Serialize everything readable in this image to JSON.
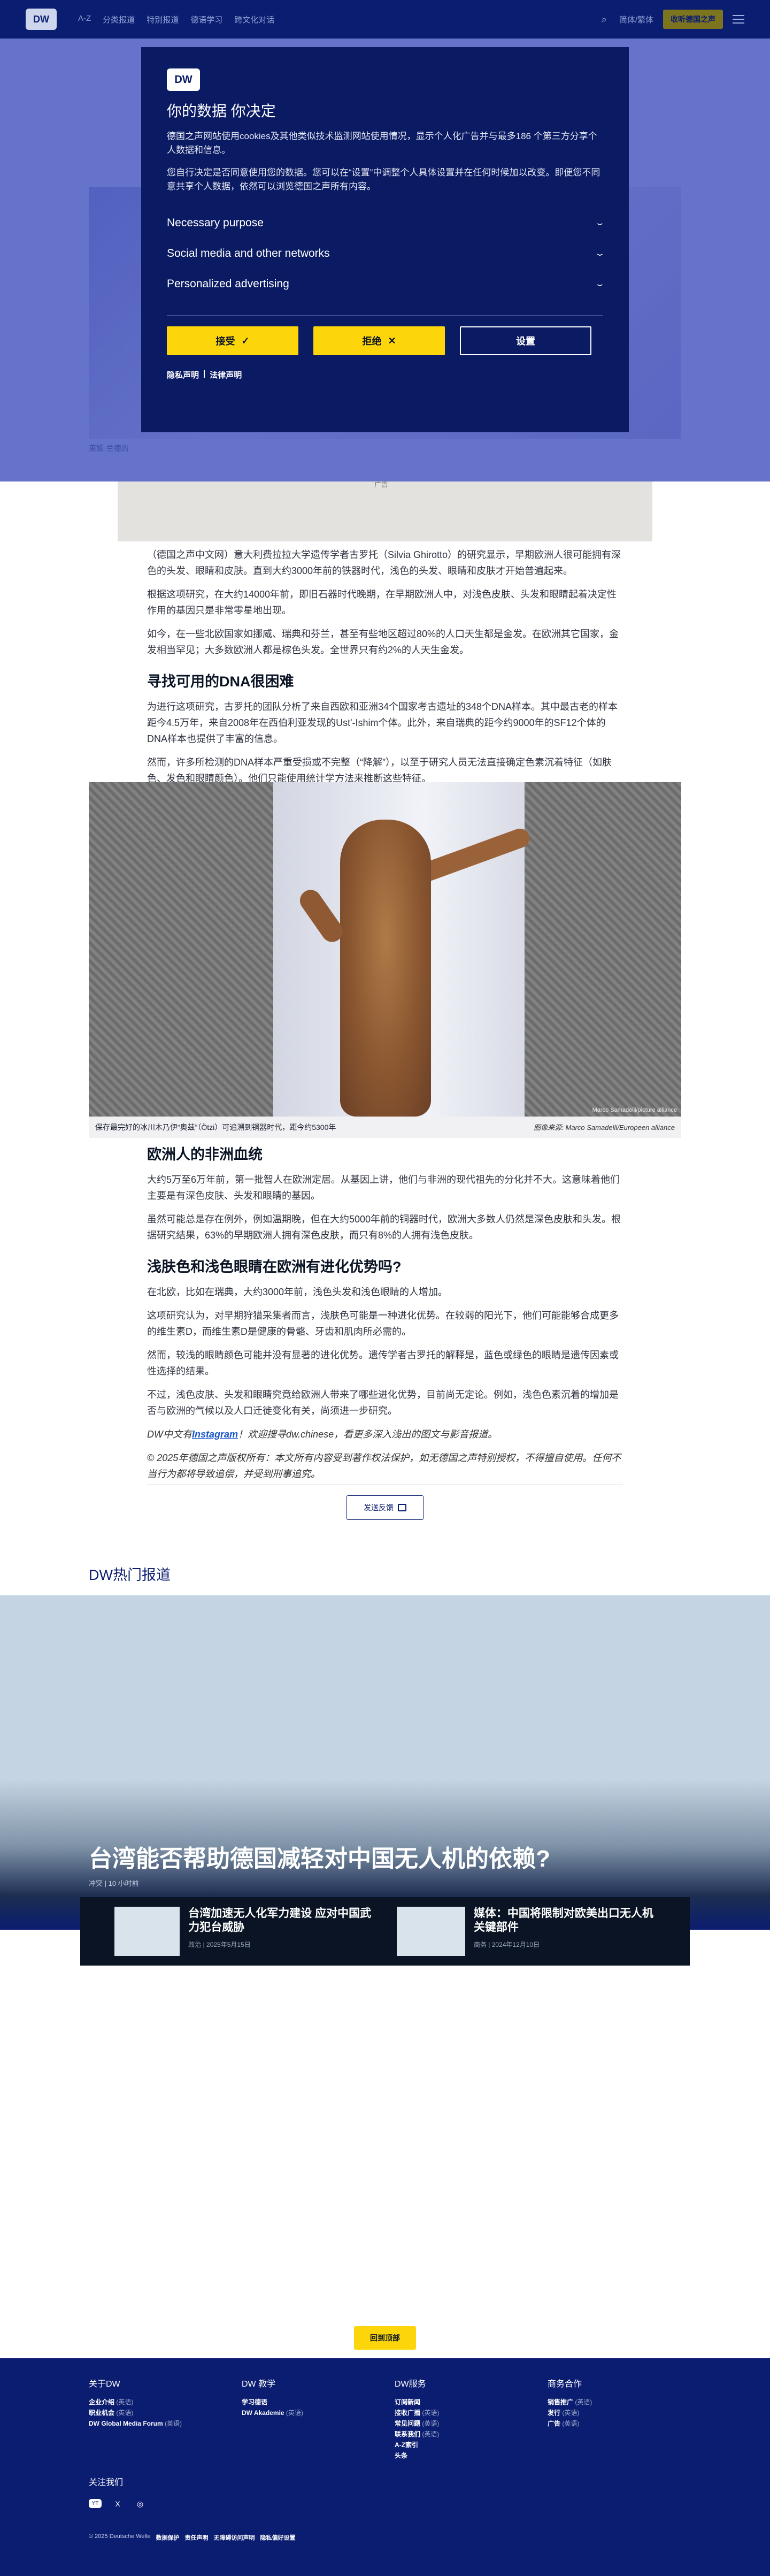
{
  "header": {
    "logo": "DW",
    "nav": [
      "A-Z",
      "分类报道",
      "特别报道",
      "德语学习",
      "跨文化对话"
    ],
    "lang": "简体/繁体",
    "cta": "收听德国之声"
  },
  "hero": {
    "caption": "莱娅·兰德的"
  },
  "consent": {
    "logo": "DW",
    "title": "你的数据 你决定",
    "p1": "德国之声网站使用cookies及其他类似技术监测网站使用情况，显示个人化广告并与最多186 个第三方分享个人数据和信息。",
    "p2": "您自行决定是否同意使用您的数据。您可以在“设置”中调整个人具体设置并在任何时候加以改变。即便您不同意共享个人数据，依然可以浏览德国之声所有内容。",
    "items": [
      "Necessary purpose",
      "Social media and other networks",
      "Personalized advertising"
    ],
    "accept": "接受",
    "reject": "拒绝",
    "settings": "设置",
    "privacy": "隐私声明",
    "legal": "法律声明",
    "sep": "|"
  },
  "article": {
    "strip_text": "广告",
    "p1": "（德国之声中文网）意大利费拉拉大学遗传学者古罗托（Silvia Ghirotto）的研究显示，早期欧洲人很可能拥有深色的头发、眼睛和皮肤。直到大约3000年前的铁器时代，浅色的头发、眼睛和皮肤才开始普遍起来。",
    "p2": "根据这项研究，在大约14000年前，即旧石器时代晚期，在早期欧洲人中，对浅色皮肤、头发和眼睛起着决定性作用的基因只是非常零星地出现。",
    "p3": "如今，在一些北欧国家如挪威、瑞典和芬兰，甚至有些地区超过80%的人口天生都是金发。在欧洲其它国家，金发相当罕见；大多数欧洲人都是棕色头发。全世界只有约2%的人天生金发。",
    "h1": "寻找可用的DNA很困难",
    "p4": "为进行这项研究，古罗托的团队分析了来自西欧和亚洲34个国家考古遗址的348个DNA样本。其中最古老的样本距今4.5万年，来自2008年在西伯利亚发现的Ust'-Ishim个体。此外，来自瑞典的距今约9000年的SF12个体的DNA样本也提供了丰富的信息。",
    "p5": "然而，许多所检测的DNA样本严重受损或不完整（“降解”），以至于研究人员无法直接确定色素沉着特征（如肤色、发色和眼睛颜色）。他们只能使用统计学方法来推断这些特征。"
  },
  "figure": {
    "caption": "保存最完好的冰川木乃伊“奥兹”（Ötzi）可追溯到铜器时代，距今约5300年",
    "credit": "图像来源: Marco Samadelli/Europeen alliance",
    "credit_in": "Marco Samadelli/picture alliance"
  },
  "article2": {
    "h1": "欧洲人的非洲血统",
    "p1": "大约5万至6万年前，第一批智人在欧洲定居。从基因上讲，他们与非洲的现代祖先的分化并不大。这意味着他们主要是有深色皮肤、头发和眼睛的基因。",
    "p2": "虽然可能总是存在例外，例如温期晚，但在大约5000年前的铜器时代，欧洲大多数人仍然是深色皮肤和头发。根据研究结果，63%的早期欧洲人拥有深色皮肤，而只有8%的人拥有浅色皮肤。",
    "h2": "浅肤色和浅色眼睛在欧洲有进化优势吗?",
    "p3": "在北欧，比如在瑞典，大约3000年前，浅色头发和浅色眼睛的人增加。",
    "p4": "这项研究认为，对早期狩猎采集者而言，浅肤色可能是一种进化优势。在较弱的阳光下，他们可能能够合成更多的维生素D，而维生素D是健康的骨骼、牙齿和肌肉所必需的。",
    "p5": "然而，较浅的眼睛颜色可能并没有显著的进化优势。遗传学者古罗托的解释是，蓝色或绿色的眼睛是遗传因素或性选择的结果。",
    "p6": "不过，浅色皮肤、头发和眼睛究竟给欧洲人带来了哪些进化优势，目前尚无定论。例如，浅色色素沉着的增加是否与欧洲的气候以及人口迁徙变化有关，尚须进一步研究。",
    "promo_pre": "DW中文有",
    "promo_link": "Instagram",
    "promo_post": "！欢迎搜寻dw.chinese，看更多深入浅出的图文与影音报道。",
    "copyright": "© 2025年德国之声版权所有：本文所有内容受到著作权法保护，如无德国之声特别授权，不得擅自使用。任何不当行为都将导致追偿，并受到刑事追究。",
    "feedback": "发送反馈"
  },
  "trending": {
    "title": "DW热门报道",
    "headline": "台湾能否帮助德国减轻对中国无人机的依赖?",
    "meta": "冲突 | 10 小时前",
    "cards": [
      {
        "title": "台湾加速无人化军力建设 应对中国武力犯台威胁",
        "meta": "政治 | 2025年5月15日"
      },
      {
        "title": "媒体：中国将限制对欧美出口无人机关键部件",
        "meta": "商务 | 2024年12月10日"
      }
    ]
  },
  "back_top": "回到顶部",
  "footer": {
    "cols": [
      {
        "title": "关于DW",
        "links": [
          [
            "企业介绍",
            "(英语)"
          ],
          [
            "职业机会",
            "(英语)"
          ],
          [
            "DW Global Media Forum",
            "(英语)"
          ]
        ]
      },
      {
        "title": "DW 教学",
        "links": [
          [
            "学习德语",
            ""
          ],
          [
            "DW Akademie",
            "(英语)"
          ]
        ]
      },
      {
        "title": "DW服务",
        "links": [
          [
            "订阅新闻",
            ""
          ],
          [
            "接收广播",
            "(英语)"
          ],
          [
            "常见问题",
            "(英语)"
          ],
          [
            "联系我们",
            "(英语)"
          ],
          [
            "A-Z索引",
            ""
          ],
          [
            "头条",
            ""
          ]
        ]
      },
      {
        "title": "商务合作",
        "links": [
          [
            "销售推广",
            "(英语)"
          ],
          [
            "发行",
            "(英语)"
          ],
          [
            "广告",
            "(英语)"
          ]
        ]
      }
    ],
    "follow": "关注我们",
    "social": [
      "YT",
      "X",
      "◎"
    ],
    "legal": [
      "© 2025 Deutsche Welle",
      "数据保护",
      "责任声明",
      "无障碍访问声明",
      "隐私偏好设置"
    ]
  }
}
